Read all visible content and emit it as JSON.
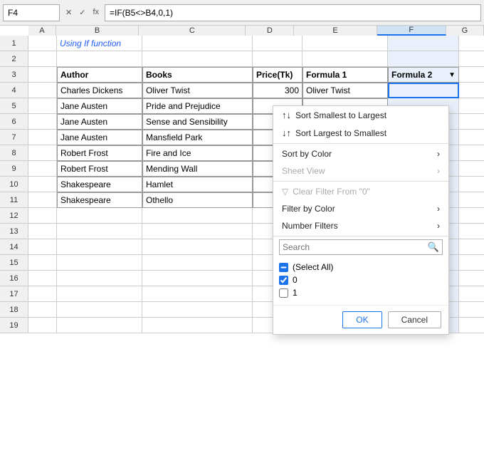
{
  "topbar": {
    "cell_ref": "F4",
    "formula": "=IF(B5<>B4,0,1)",
    "fx_label": "fx"
  },
  "columns": {
    "headers": [
      "A",
      "B",
      "C",
      "D",
      "E",
      "F",
      "G"
    ],
    "widths": [
      40,
      120,
      155,
      70,
      120,
      100,
      55
    ]
  },
  "rows": [
    {
      "num": 1,
      "cells": [
        "",
        "Using If function",
        "",
        "",
        "",
        "",
        ""
      ]
    },
    {
      "num": 2,
      "cells": [
        "",
        "",
        "",
        "",
        "",
        "",
        ""
      ]
    },
    {
      "num": 3,
      "cells": [
        "",
        "Author",
        "Books",
        "Price(Tk)",
        "Formula 1",
        "Formula 2",
        ""
      ]
    },
    {
      "num": 4,
      "cells": [
        "",
        "Charles Dickens",
        "Oliver Twist",
        "300",
        "Oliver Twist",
        "",
        ""
      ]
    },
    {
      "num": 5,
      "cells": [
        "",
        "Jane Austen",
        "Pride and Prejudice",
        "",
        "",
        "",
        ""
      ]
    },
    {
      "num": 6,
      "cells": [
        "",
        "Jane Austen",
        "Sense and Sensibility",
        "",
        "",
        "",
        ""
      ]
    },
    {
      "num": 7,
      "cells": [
        "",
        "Jane Austen",
        "Mansfield Park",
        "",
        "",
        "",
        ""
      ]
    },
    {
      "num": 8,
      "cells": [
        "",
        "Robert Frost",
        "Fire and Ice",
        "",
        "",
        "",
        ""
      ]
    },
    {
      "num": 9,
      "cells": [
        "",
        "Robert Frost",
        "Mending Wall",
        "",
        "",
        "",
        ""
      ]
    },
    {
      "num": 10,
      "cells": [
        "",
        "Shakespeare",
        "Hamlet",
        "",
        "",
        "",
        ""
      ]
    },
    {
      "num": 11,
      "cells": [
        "",
        "Shakespeare",
        "Othello",
        "",
        "",
        "",
        ""
      ]
    },
    {
      "num": 12,
      "cells": [
        "",
        "",
        "",
        "",
        "",
        "",
        ""
      ]
    },
    {
      "num": 13,
      "cells": [
        "",
        "",
        "",
        "",
        "",
        "",
        ""
      ]
    },
    {
      "num": 14,
      "cells": [
        "",
        "",
        "",
        "",
        "",
        "",
        ""
      ]
    },
    {
      "num": 15,
      "cells": [
        "",
        "",
        "",
        "",
        "",
        "",
        ""
      ]
    },
    {
      "num": 16,
      "cells": [
        "",
        "",
        "",
        "",
        "",
        "",
        ""
      ]
    },
    {
      "num": 17,
      "cells": [
        "",
        "",
        "",
        "",
        "",
        "",
        ""
      ]
    },
    {
      "num": 18,
      "cells": [
        "",
        "",
        "",
        "",
        "",
        "",
        ""
      ]
    },
    {
      "num": 19,
      "cells": [
        "",
        "",
        "",
        "",
        "",
        "",
        ""
      ]
    }
  ],
  "dropdown": {
    "items": [
      {
        "type": "item",
        "icon": "↕",
        "label": "Sort Smallest to Largest",
        "disabled": false,
        "arrow": false
      },
      {
        "type": "item",
        "icon": "↕",
        "label": "Sort Largest to Smallest",
        "disabled": false,
        "arrow": false
      },
      {
        "type": "item",
        "icon": "",
        "label": "Sort by Color",
        "disabled": false,
        "arrow": true
      },
      {
        "type": "item",
        "icon": "",
        "label": "Sheet View",
        "disabled": true,
        "arrow": true
      },
      {
        "type": "item",
        "icon": "🔽",
        "label": "Clear Filter From \"0\"",
        "disabled": true,
        "arrow": false
      },
      {
        "type": "item",
        "icon": "",
        "label": "Filter by Color",
        "disabled": false,
        "arrow": true
      },
      {
        "type": "item",
        "icon": "",
        "label": "Number Filters",
        "disabled": false,
        "arrow": true
      }
    ],
    "search_placeholder": "Search",
    "checkboxes": [
      {
        "label": "(Select All)",
        "checked": "indeterminate"
      },
      {
        "label": "0",
        "checked": true
      },
      {
        "label": "1",
        "checked": false
      }
    ],
    "ok_label": "OK",
    "cancel_label": "Cancel"
  }
}
